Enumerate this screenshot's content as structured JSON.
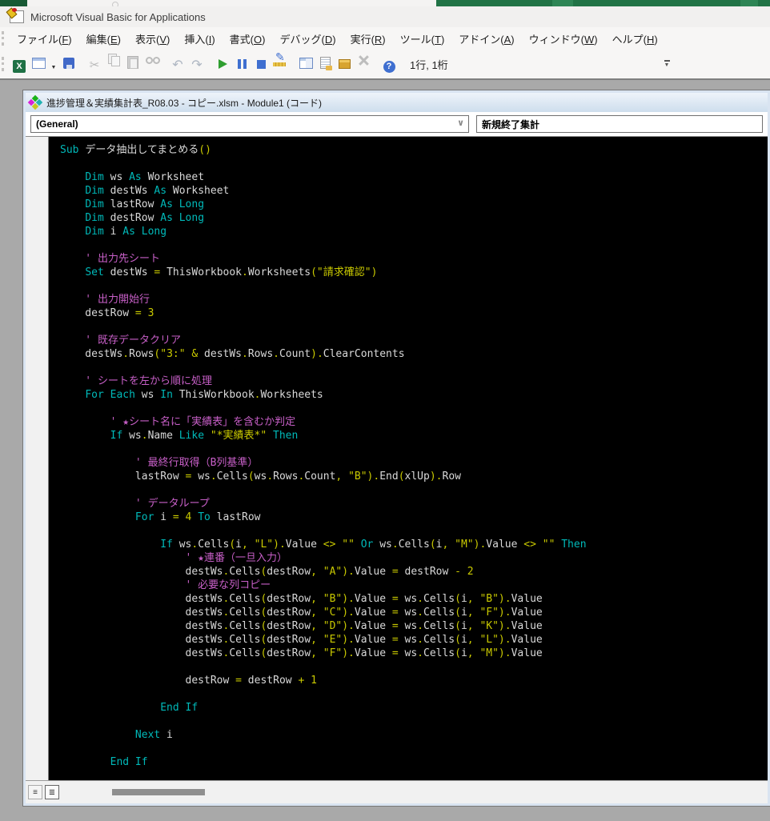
{
  "excel_strip": {
    "corner_color": "#185a34",
    "light_color": "#f4f3f2",
    "green_color": "#217346"
  },
  "titlebar": {
    "title": "Microsoft Visual Basic for Applications"
  },
  "menubar": {
    "items": [
      "ファイル(F)",
      "編集(E)",
      "表示(V)",
      "挿入(I)",
      "書式(O)",
      "デバッグ(D)",
      "実行(R)",
      "ツール(T)",
      "アドイン(A)",
      "ウィンドウ(W)",
      "ヘルプ(H)"
    ]
  },
  "toolbar": {
    "items": [
      {
        "name": "view-excel-icon",
        "kind": "excel",
        "enabled": true
      },
      {
        "name": "insert-userform-icon",
        "kind": "userform",
        "enabled": true
      },
      {
        "name": "insert-dropdown-icon",
        "kind": "dd",
        "enabled": true
      },
      {
        "name": "save-icon",
        "kind": "save",
        "enabled": true
      },
      {
        "name": "sep1",
        "kind": "sep"
      },
      {
        "name": "cut-icon",
        "kind": "cut",
        "enabled": false
      },
      {
        "name": "copy-icon",
        "kind": "copy",
        "enabled": false
      },
      {
        "name": "paste-icon",
        "kind": "paste",
        "enabled": false
      },
      {
        "name": "find-icon",
        "kind": "find",
        "enabled": false
      },
      {
        "name": "sep2",
        "kind": "sep"
      },
      {
        "name": "undo-icon",
        "kind": "undo",
        "enabled": false
      },
      {
        "name": "redo-icon",
        "kind": "redo",
        "enabled": false
      },
      {
        "name": "sep3",
        "kind": "sep"
      },
      {
        "name": "run-icon",
        "kind": "run",
        "enabled": true
      },
      {
        "name": "break-icon",
        "kind": "break",
        "enabled": true
      },
      {
        "name": "reset-icon",
        "kind": "reset",
        "enabled": true
      },
      {
        "name": "design-mode-icon",
        "kind": "design",
        "enabled": true
      },
      {
        "name": "sep4",
        "kind": "sep"
      },
      {
        "name": "project-explorer-icon",
        "kind": "proj",
        "enabled": true
      },
      {
        "name": "properties-window-icon",
        "kind": "props",
        "enabled": true
      },
      {
        "name": "object-browser-icon",
        "kind": "objb",
        "enabled": true
      },
      {
        "name": "toolbox-icon",
        "kind": "toolbox",
        "enabled": false
      },
      {
        "name": "sep5",
        "kind": "sep"
      },
      {
        "name": "help-icon",
        "kind": "help",
        "enabled": true
      }
    ],
    "status": "1行, 1桁"
  },
  "code_window": {
    "title": "進捗管理＆実績集計表_R08.03 - コピー.xlsm - Module1 (コード)",
    "left_dropdown": "(General)",
    "right_dropdown": "新規終了集計",
    "colors": {
      "background": "#000000",
      "keyword": "#00b9b9",
      "normal": "#d9d9d9",
      "operator_string": "#c9c900",
      "comment": "#c75fc7"
    },
    "lines": [
      [
        [
          "k",
          "Sub "
        ],
        [
          "n",
          "データ抽出してまとめる"
        ],
        [
          "y",
          "()"
        ]
      ],
      [],
      [
        [
          "n",
          "    "
        ],
        [
          "k",
          "Dim"
        ],
        [
          "n",
          " ws "
        ],
        [
          "k",
          "As"
        ],
        [
          "n",
          " Worksheet"
        ]
      ],
      [
        [
          "n",
          "    "
        ],
        [
          "k",
          "Dim"
        ],
        [
          "n",
          " destWs "
        ],
        [
          "k",
          "As"
        ],
        [
          "n",
          " Worksheet"
        ]
      ],
      [
        [
          "n",
          "    "
        ],
        [
          "k",
          "Dim"
        ],
        [
          "n",
          " lastRow "
        ],
        [
          "k",
          "As"
        ],
        [
          "n",
          " "
        ],
        [
          "k",
          "Long"
        ]
      ],
      [
        [
          "n",
          "    "
        ],
        [
          "k",
          "Dim"
        ],
        [
          "n",
          " destRow "
        ],
        [
          "k",
          "As"
        ],
        [
          "n",
          " "
        ],
        [
          "k",
          "Long"
        ]
      ],
      [
        [
          "n",
          "    "
        ],
        [
          "k",
          "Dim"
        ],
        [
          "n",
          " i "
        ],
        [
          "k",
          "As"
        ],
        [
          "n",
          " "
        ],
        [
          "k",
          "Long"
        ]
      ],
      [],
      [
        [
          "c",
          "    ' 出力先シート"
        ]
      ],
      [
        [
          "n",
          "    "
        ],
        [
          "k",
          "Set"
        ],
        [
          "n",
          " destWs "
        ],
        [
          "y",
          "="
        ],
        [
          "n",
          " ThisWorkbook"
        ],
        [
          "y",
          "."
        ],
        [
          "n",
          "Worksheets"
        ],
        [
          "y",
          "(\"請求確認\")"
        ]
      ],
      [],
      [
        [
          "c",
          "    ' 出力開始行"
        ]
      ],
      [
        [
          "n",
          "    destRow "
        ],
        [
          "y",
          "= 3"
        ]
      ],
      [],
      [
        [
          "c",
          "    ' 既存データクリア"
        ]
      ],
      [
        [
          "n",
          "    destWs"
        ],
        [
          "y",
          "."
        ],
        [
          "n",
          "Rows"
        ],
        [
          "y",
          "(\"3:\" & "
        ],
        [
          "n",
          "destWs"
        ],
        [
          "y",
          "."
        ],
        [
          "n",
          "Rows"
        ],
        [
          "y",
          "."
        ],
        [
          "n",
          "Count"
        ],
        [
          "y",
          ")."
        ],
        [
          "n",
          "ClearContents"
        ]
      ],
      [],
      [
        [
          "c",
          "    ' シートを左から順に処理"
        ]
      ],
      [
        [
          "n",
          "    "
        ],
        [
          "k",
          "For Each"
        ],
        [
          "n",
          " ws "
        ],
        [
          "k",
          "In"
        ],
        [
          "n",
          " ThisWorkbook"
        ],
        [
          "y",
          "."
        ],
        [
          "n",
          "Worksheets"
        ]
      ],
      [],
      [
        [
          "c",
          "        ' ★シート名に「実績表」を含むか判定"
        ]
      ],
      [
        [
          "n",
          "        "
        ],
        [
          "k",
          "If"
        ],
        [
          "n",
          " ws"
        ],
        [
          "y",
          "."
        ],
        [
          "n",
          "Name "
        ],
        [
          "k",
          "Like"
        ],
        [
          "n",
          " "
        ],
        [
          "y",
          "\"*実績表*\""
        ],
        [
          "n",
          " "
        ],
        [
          "k",
          "Then"
        ]
      ],
      [],
      [
        [
          "c",
          "            ' 最終行取得（B列基準）"
        ]
      ],
      [
        [
          "n",
          "            lastRow "
        ],
        [
          "y",
          "="
        ],
        [
          "n",
          " ws"
        ],
        [
          "y",
          "."
        ],
        [
          "n",
          "Cells"
        ],
        [
          "y",
          "("
        ],
        [
          "n",
          "ws"
        ],
        [
          "y",
          "."
        ],
        [
          "n",
          "Rows"
        ],
        [
          "y",
          "."
        ],
        [
          "n",
          "Count"
        ],
        [
          "y",
          ", \"B\")."
        ],
        [
          "n",
          "End"
        ],
        [
          "y",
          "("
        ],
        [
          "n",
          "xlUp"
        ],
        [
          "y",
          ")."
        ],
        [
          "n",
          "Row"
        ]
      ],
      [],
      [
        [
          "c",
          "            ' データループ"
        ]
      ],
      [
        [
          "n",
          "            "
        ],
        [
          "k",
          "For"
        ],
        [
          "n",
          " i "
        ],
        [
          "y",
          "= 4"
        ],
        [
          "n",
          " "
        ],
        [
          "k",
          "To"
        ],
        [
          "n",
          " lastRow"
        ]
      ],
      [],
      [
        [
          "n",
          "                "
        ],
        [
          "k",
          "If"
        ],
        [
          "n",
          " ws"
        ],
        [
          "y",
          "."
        ],
        [
          "n",
          "Cells"
        ],
        [
          "y",
          "("
        ],
        [
          "n",
          "i"
        ],
        [
          "y",
          ", \"L\")."
        ],
        [
          "n",
          "Value "
        ],
        [
          "y",
          "<> \"\""
        ],
        [
          "n",
          " "
        ],
        [
          "k",
          "Or"
        ],
        [
          "n",
          " ws"
        ],
        [
          "y",
          "."
        ],
        [
          "n",
          "Cells"
        ],
        [
          "y",
          "("
        ],
        [
          "n",
          "i"
        ],
        [
          "y",
          ", \"M\")."
        ],
        [
          "n",
          "Value "
        ],
        [
          "y",
          "<> \"\""
        ],
        [
          "n",
          " "
        ],
        [
          "k",
          "Then"
        ]
      ],
      [
        [
          "c",
          "                    ' ★連番（一旦入力）"
        ]
      ],
      [
        [
          "n",
          "                    destWs"
        ],
        [
          "y",
          "."
        ],
        [
          "n",
          "Cells"
        ],
        [
          "y",
          "("
        ],
        [
          "n",
          "destRow"
        ],
        [
          "y",
          ", \"A\")."
        ],
        [
          "n",
          "Value "
        ],
        [
          "y",
          "="
        ],
        [
          "n",
          " destRow "
        ],
        [
          "y",
          "- 2"
        ]
      ],
      [
        [
          "c",
          "                    ' 必要な列コピー"
        ]
      ],
      [
        [
          "n",
          "                    destWs"
        ],
        [
          "y",
          "."
        ],
        [
          "n",
          "Cells"
        ],
        [
          "y",
          "("
        ],
        [
          "n",
          "destRow"
        ],
        [
          "y",
          ", \"B\")."
        ],
        [
          "n",
          "Value "
        ],
        [
          "y",
          "="
        ],
        [
          "n",
          " ws"
        ],
        [
          "y",
          "."
        ],
        [
          "n",
          "Cells"
        ],
        [
          "y",
          "("
        ],
        [
          "n",
          "i"
        ],
        [
          "y",
          ", \"B\")."
        ],
        [
          "n",
          "Value"
        ]
      ],
      [
        [
          "n",
          "                    destWs"
        ],
        [
          "y",
          "."
        ],
        [
          "n",
          "Cells"
        ],
        [
          "y",
          "("
        ],
        [
          "n",
          "destRow"
        ],
        [
          "y",
          ", \"C\")."
        ],
        [
          "n",
          "Value "
        ],
        [
          "y",
          "="
        ],
        [
          "n",
          " ws"
        ],
        [
          "y",
          "."
        ],
        [
          "n",
          "Cells"
        ],
        [
          "y",
          "("
        ],
        [
          "n",
          "i"
        ],
        [
          "y",
          ", \"F\")."
        ],
        [
          "n",
          "Value"
        ]
      ],
      [
        [
          "n",
          "                    destWs"
        ],
        [
          "y",
          "."
        ],
        [
          "n",
          "Cells"
        ],
        [
          "y",
          "("
        ],
        [
          "n",
          "destRow"
        ],
        [
          "y",
          ", \"D\")."
        ],
        [
          "n",
          "Value "
        ],
        [
          "y",
          "="
        ],
        [
          "n",
          " ws"
        ],
        [
          "y",
          "."
        ],
        [
          "n",
          "Cells"
        ],
        [
          "y",
          "("
        ],
        [
          "n",
          "i"
        ],
        [
          "y",
          ", \"K\")."
        ],
        [
          "n",
          "Value"
        ]
      ],
      [
        [
          "n",
          "                    destWs"
        ],
        [
          "y",
          "."
        ],
        [
          "n",
          "Cells"
        ],
        [
          "y",
          "("
        ],
        [
          "n",
          "destRow"
        ],
        [
          "y",
          ", \"E\")."
        ],
        [
          "n",
          "Value "
        ],
        [
          "y",
          "="
        ],
        [
          "n",
          " ws"
        ],
        [
          "y",
          "."
        ],
        [
          "n",
          "Cells"
        ],
        [
          "y",
          "("
        ],
        [
          "n",
          "i"
        ],
        [
          "y",
          ", \"L\")."
        ],
        [
          "n",
          "Value"
        ]
      ],
      [
        [
          "n",
          "                    destWs"
        ],
        [
          "y",
          "."
        ],
        [
          "n",
          "Cells"
        ],
        [
          "y",
          "("
        ],
        [
          "n",
          "destRow"
        ],
        [
          "y",
          ", \"F\")."
        ],
        [
          "n",
          "Value "
        ],
        [
          "y",
          "="
        ],
        [
          "n",
          " ws"
        ],
        [
          "y",
          "."
        ],
        [
          "n",
          "Cells"
        ],
        [
          "y",
          "("
        ],
        [
          "n",
          "i"
        ],
        [
          "y",
          ", \"M\")."
        ],
        [
          "n",
          "Value"
        ]
      ],
      [],
      [
        [
          "n",
          "                    destRow "
        ],
        [
          "y",
          "="
        ],
        [
          "n",
          " destRow "
        ],
        [
          "y",
          "+ 1"
        ]
      ],
      [],
      [
        [
          "n",
          "                "
        ],
        [
          "k",
          "End If"
        ]
      ],
      [],
      [
        [
          "n",
          "            "
        ],
        [
          "k",
          "Next"
        ],
        [
          "n",
          " i"
        ]
      ],
      [],
      [
        [
          "n",
          "        "
        ],
        [
          "k",
          "End If"
        ]
      ]
    ]
  }
}
